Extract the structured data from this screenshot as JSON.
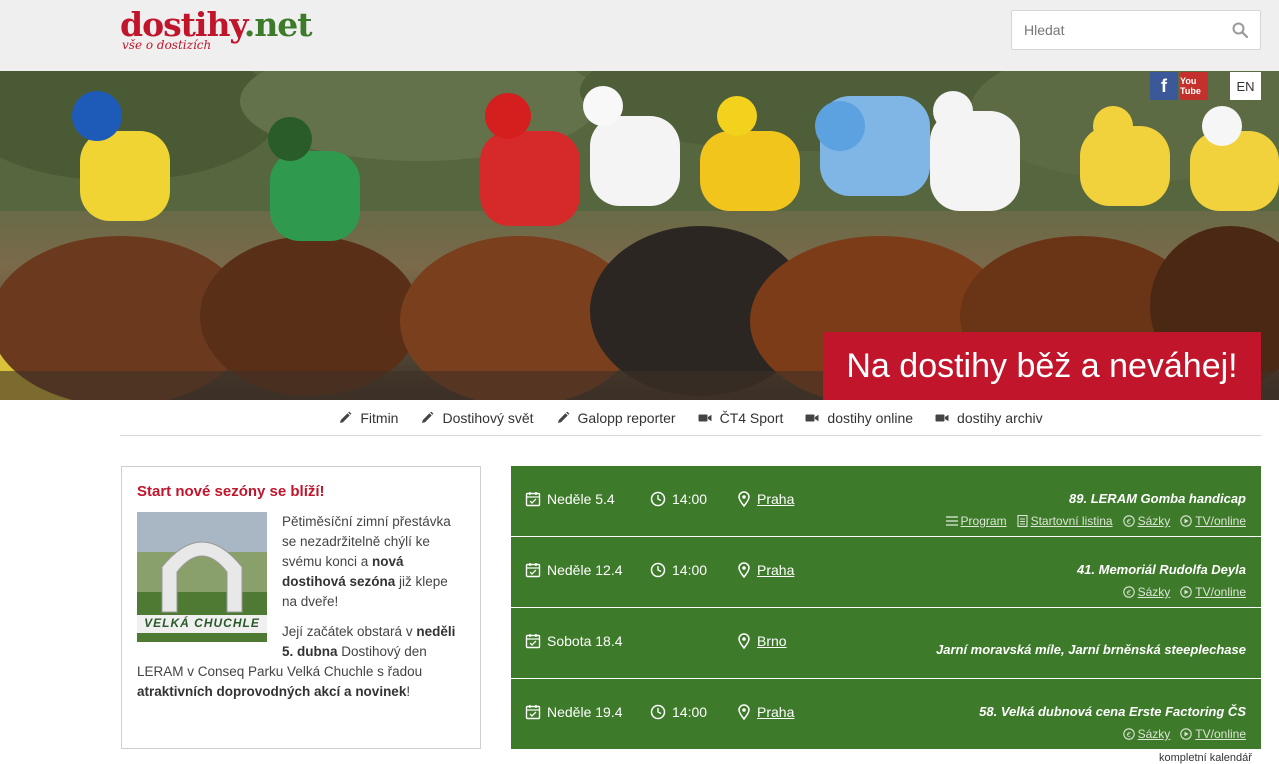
{
  "logo": {
    "main_part1": "dostihy",
    "main_part2": ".net",
    "tagline": "vše o dostizích"
  },
  "search": {
    "placeholder": "Hledat"
  },
  "hero": {
    "social_facebook": "f",
    "social_youtube": "You Tube",
    "lang": "EN",
    "slogan": "Na dostihy běž a neváhej!"
  },
  "subnav": [
    {
      "label": "Fitmin",
      "icon": "pencil-icon"
    },
    {
      "label": "Dostihový svět",
      "icon": "pencil-icon"
    },
    {
      "label": "Galopp reporter",
      "icon": "pencil-icon"
    },
    {
      "label": "ČT4 Sport",
      "icon": "video-camera-icon"
    },
    {
      "label": "dostihy online",
      "icon": "video-camera-icon"
    },
    {
      "label": "dostihy archiv",
      "icon": "video-camera-icon"
    }
  ],
  "news": {
    "title": "Start nové sezóny se blíží!",
    "image_sign_top": "VELKÁ CHUCHLE",
    "image_sign_bottom": "VELKÁ CHUCHLE",
    "p1_a": "Pětiměsíční zimní přestávka se nezadržitelně chýlí ke svému konci a ",
    "p1_b": "nová dostihová sezóna",
    "p1_c": " již klepe na dveře!",
    "p2_a": "Její začátek obstará v ",
    "p2_b": "neděli 5. dubna",
    "p2_c": " Dostihový den LERAM v Conseq Parku Velká Chuchle s řadou ",
    "p2_d": "atraktivních doprovodných akcí a novinek",
    "p2_e": "!"
  },
  "calendar": {
    "races": [
      {
        "date": "Neděle 5.4",
        "time": "14:00",
        "place": "Praha",
        "name": "89. LERAM Gomba handicap",
        "links": [
          "Program",
          "Startovní listina",
          "Sázky",
          "TV/online"
        ]
      },
      {
        "date": "Neděle 12.4",
        "time": "14:00",
        "place": "Praha",
        "name": "41. Memoriál Rudolfa Deyla",
        "links": [
          "Sázky",
          "TV/online"
        ]
      },
      {
        "date": "Sobota 18.4",
        "time": "",
        "place": "Brno",
        "name": "Jarní moravská míle, Jarní brněnská steeplechase",
        "links": []
      },
      {
        "date": "Neděle 19.4",
        "time": "14:00",
        "place": "Praha",
        "name": "58. Velká dubnová cena Erste Factoring ČS",
        "links": [
          "Sázky",
          "TV/online"
        ]
      }
    ],
    "full_link": "kompletní kalendář"
  },
  "colors": {
    "brand_red": "#c0152b",
    "brand_green": "#3d7a2a"
  }
}
